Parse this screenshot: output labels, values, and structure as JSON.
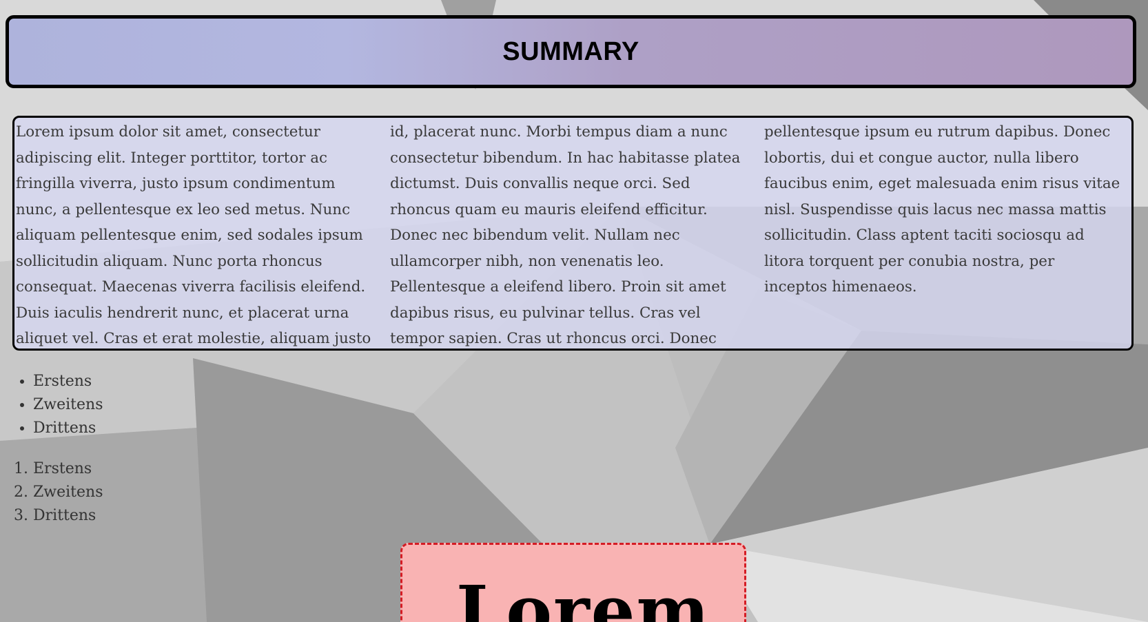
{
  "header": {
    "title": "SUMMARY"
  },
  "article": {
    "text": "Lorem ipsum dolor sit amet, consectetur adipiscing elit. Integer porttitor, tortor ac fringilla viverra, justo ipsum condimentum nunc, a pellentesque ex leo sed metus. Nunc aliquam pellentesque enim, sed sodales ipsum sollicitudin aliquam. Nunc porta rhoncus consequat. Maecenas viverra facilisis eleifend. Duis iaculis hendrerit nunc, et placerat urna aliquet vel. Cras et erat molestie, aliquam justo id, placerat nunc. Morbi tempus diam a nunc consectetur bibendum. In hac habitasse platea dictumst. Duis convallis neque orci. Sed rhoncus quam eu mauris eleifend efficitur. Donec nec bibendum velit. Nullam nec ullamcorper nibh, non venenatis leo. Pellentesque a eleifend libero. Proin sit amet dapibus risus, eu pulvinar tellus. Cras vel tempor sapien. Cras ut rhoncus orci. Donec pellentesque ipsum eu rutrum dapibus. Donec lobortis, dui et congue auctor, nulla libero faucibus enim, eget malesuada enim risus vitae nisl. Suspendisse quis lacus nec massa mattis sollicitudin. Class aptent taciti sociosqu ad litora torquent per conubia nostra, per inceptos himenaeos."
  },
  "unordered_list": {
    "items": [
      "Erstens",
      "Zweitens",
      "Drittens"
    ]
  },
  "ordered_list": {
    "items": [
      "Erstens",
      "Zweitens",
      "Drittens"
    ]
  },
  "card": {
    "heading": "Lorem"
  },
  "colors": {
    "header_gradient_left": "#aeb3dc",
    "header_gradient_right": "#ae98bd",
    "text_box_bg": "#d6d7f0",
    "card_bg": "#f9b3b3",
    "card_border": "#d41c24"
  }
}
